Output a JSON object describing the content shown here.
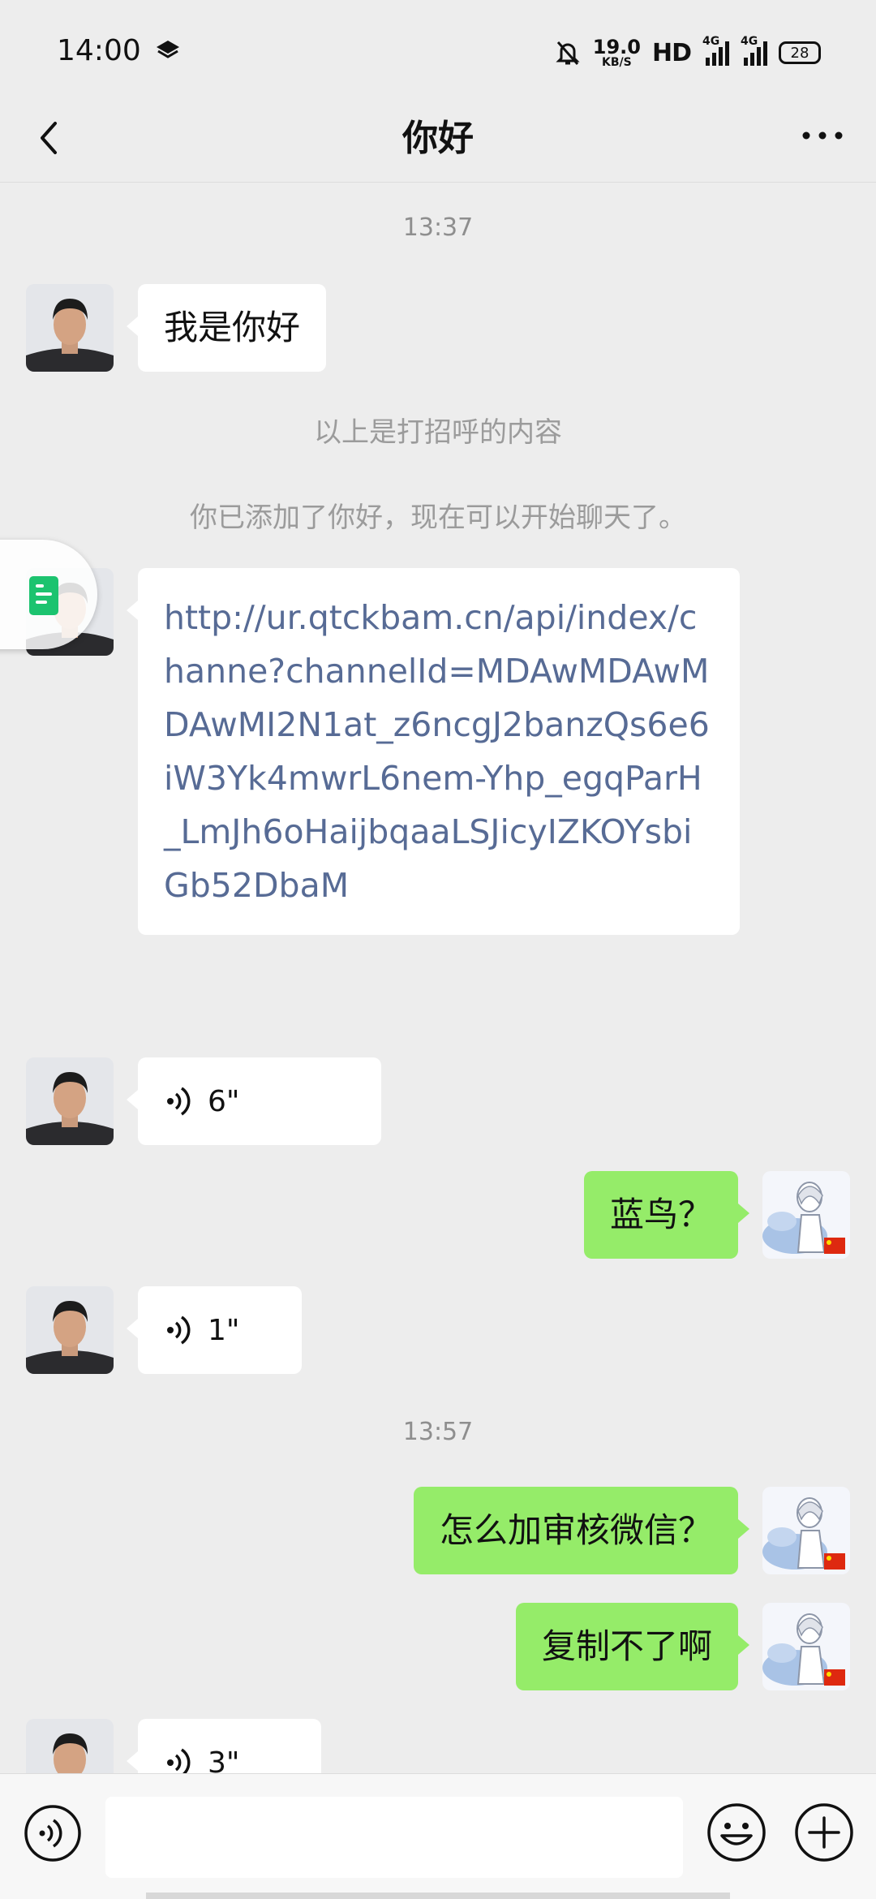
{
  "status_bar": {
    "time": "14:00",
    "net_speed_value": "19.0",
    "net_speed_unit": "KB/S",
    "hd": "HD",
    "signal1_label": "4G",
    "signal2_label": "4G",
    "battery": "28",
    "icons": [
      "layers-icon",
      "mute-bell-icon",
      "signal-icon",
      "battery-icon"
    ]
  },
  "nav": {
    "title": "你好",
    "icons": [
      "back-arrow-icon",
      "more-dots-icon"
    ]
  },
  "messages": {
    "time1": "13:37",
    "greeting": "我是你好",
    "system1": "以上是打招呼的内容",
    "system2": "你已添加了你好，现在可以开始聊天了。",
    "link": "http://ur.qtckbam.cn/api/index/channe?channelId=MDAwMDAwMDAwMI2N1at_z6ncgJ2banzQs6e6iW3Yk4mwrL6nem-Yhp_egqParH_LmJh6oHaijbqaaLSJicyIZKOYsbiGb52DbaM",
    "voice1": "6\"",
    "reply1": "蓝鸟？",
    "voice2": "1\"",
    "time2": "13:57",
    "reply2": "怎么加审核微信？",
    "reply3": "复制不了啊",
    "voice3": "3\""
  },
  "input_bar": {
    "text_value": "",
    "icons": [
      "voice-toggle-icon",
      "emoji-icon",
      "plus-icon"
    ]
  },
  "colors": {
    "background": "#ededed",
    "out_bubble": "#95ec69",
    "in_bubble": "#ffffff",
    "link": "#576b95"
  }
}
